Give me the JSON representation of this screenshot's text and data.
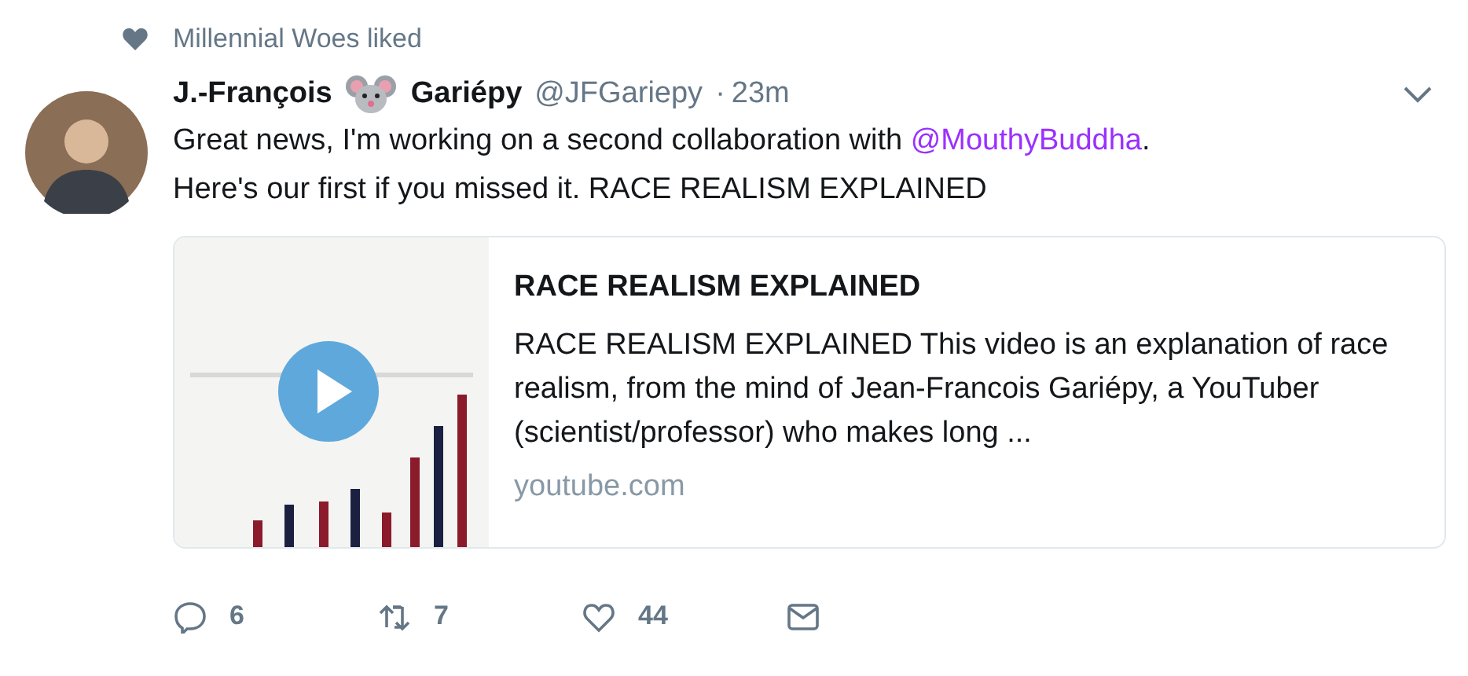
{
  "context": {
    "text": "Millennial Woes liked"
  },
  "tweet": {
    "name_first": "J.-François",
    "name_last": "Gariépy",
    "handle": "@JFGariepy",
    "separator": "·",
    "time": "23m",
    "text": [
      {
        "kind": "plain",
        "text": "Great news, I'm working on a second collaboration with "
      },
      {
        "kind": "mention",
        "text": "@MouthyBuddha"
      },
      {
        "kind": "plain",
        "text": "."
      },
      {
        "kind": "break"
      },
      {
        "kind": "plain",
        "text": "Here's our first if you missed it. RACE REALISM EXPLAINED"
      }
    ],
    "card": {
      "title": "RACE REALISM EXPLAINED",
      "description": "RACE REALISM EXPLAINED This video is an explanation of race realism, from the mind of Jean-Francois Gariépy, a YouTuber (scientist/professor) who makes long ...",
      "domain": "youtube.com"
    },
    "actions": [
      {
        "kind": "reply",
        "count": "6"
      },
      {
        "kind": "retweet",
        "count": "7"
      },
      {
        "kind": "like",
        "count": "44"
      },
      {
        "kind": "message"
      }
    ]
  }
}
